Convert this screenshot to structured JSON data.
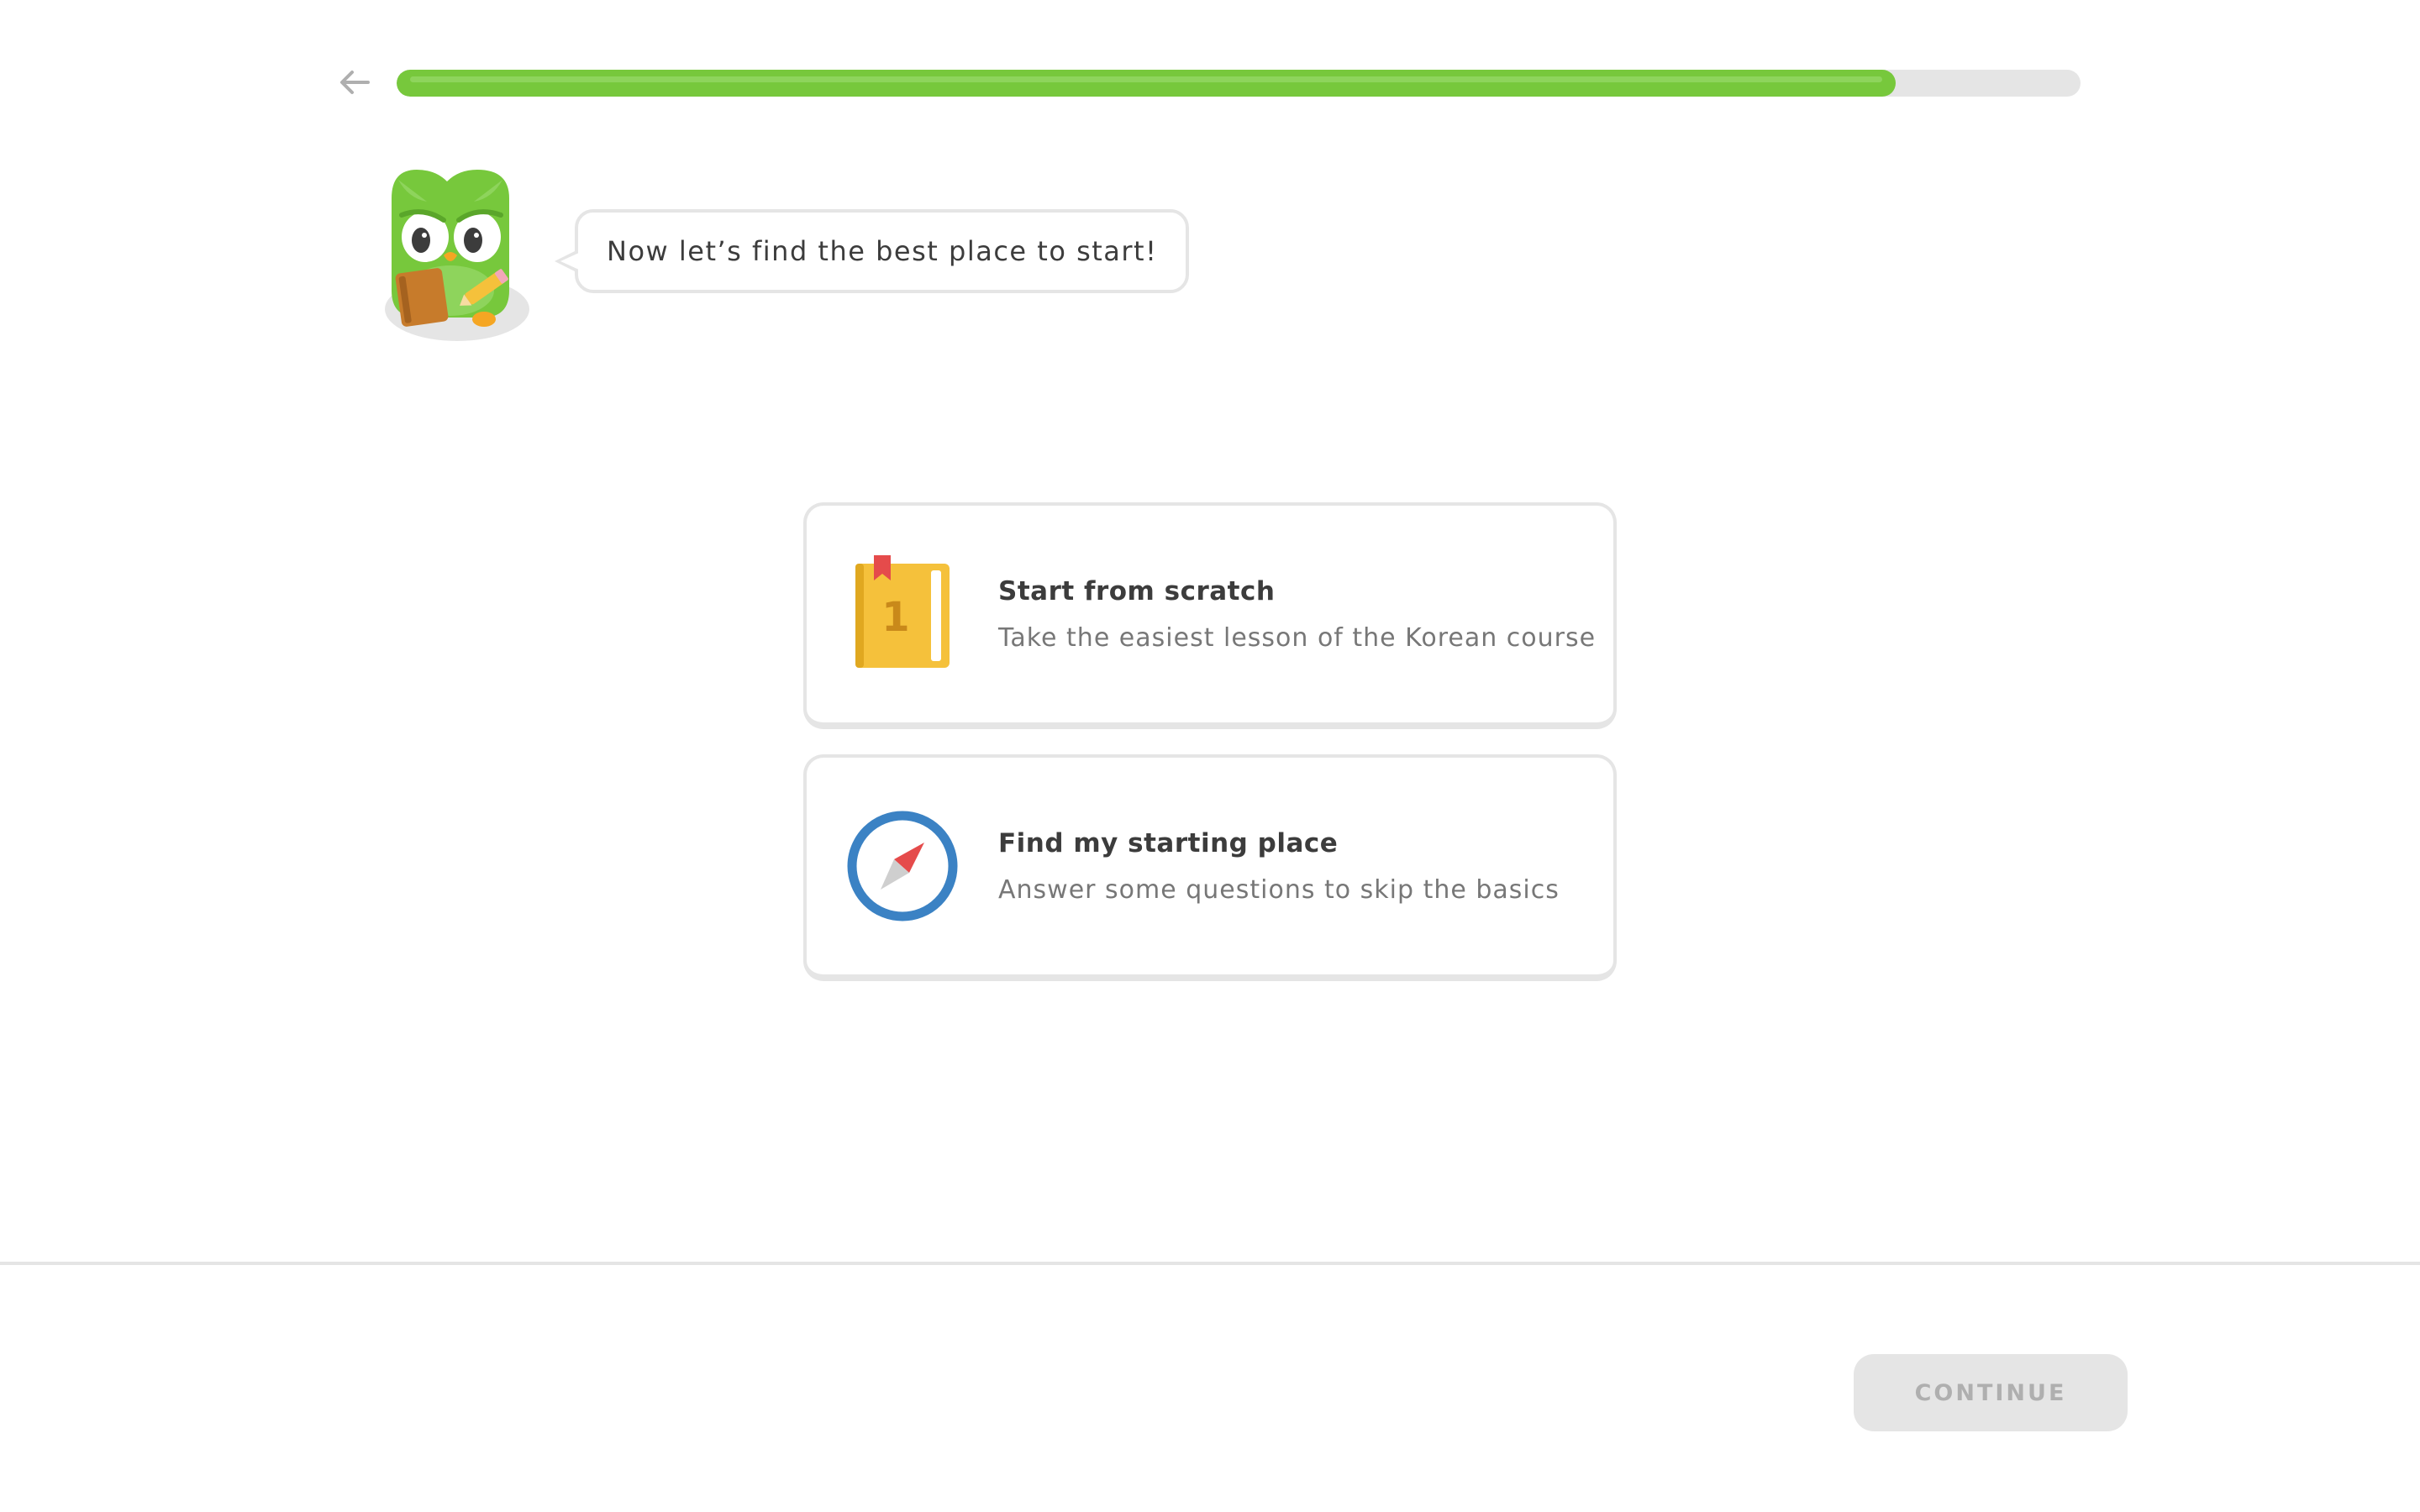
{
  "header": {
    "back_icon": "arrow-left-icon",
    "progress_fraction": 0.89,
    "progress_color": "#77c83c",
    "track_color": "#e5e5e5"
  },
  "mascot": {
    "icon": "owl-mascot-icon",
    "speech": "Now let’s find the best place to start!"
  },
  "options": [
    {
      "icon": "book-icon",
      "book_number": "1",
      "title": "Start from scratch",
      "subtitle": "Take the easiest lesson of the Korean course"
    },
    {
      "icon": "compass-icon",
      "title": "Find my starting place",
      "subtitle": "Answer some questions to skip the basics"
    }
  ],
  "footer": {
    "continue_label": "CONTINUE"
  },
  "colors": {
    "accent_green": "#77c83c",
    "border_gray": "#e5e5e5",
    "text_dark": "#3c3c3c",
    "text_muted": "#777777",
    "compass_blue": "#3b82c4",
    "book_yellow": "#f5c13b",
    "bookmark_red": "#e54b4b"
  }
}
